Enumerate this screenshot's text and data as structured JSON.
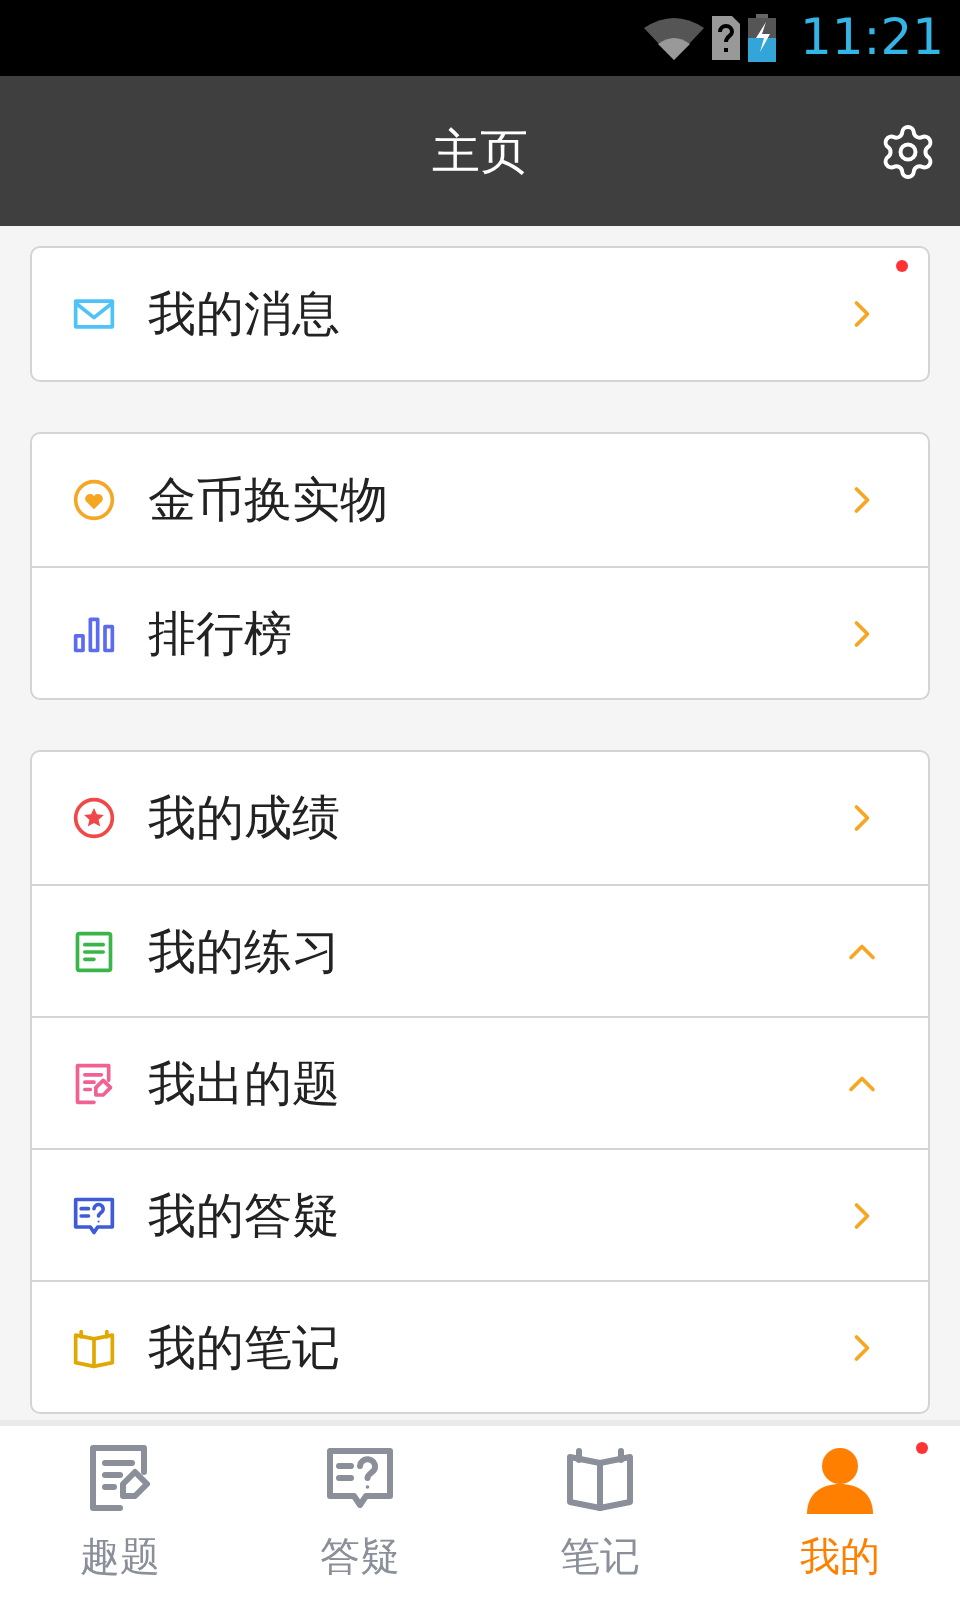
{
  "status_bar": {
    "time": "11:21"
  },
  "header": {
    "title": "主页"
  },
  "groups": [
    {
      "items": [
        {
          "label": "我的消息",
          "expanded": false,
          "badge": true
        }
      ]
    },
    {
      "items": [
        {
          "label": "金币换实物",
          "expanded": false,
          "badge": false
        },
        {
          "label": "排行榜",
          "expanded": false,
          "badge": false
        }
      ]
    },
    {
      "items": [
        {
          "label": "我的成绩",
          "expanded": false,
          "badge": false
        },
        {
          "label": "我的练习",
          "expanded": true,
          "badge": false
        },
        {
          "label": "我出的题",
          "expanded": true,
          "badge": false
        },
        {
          "label": "我的答疑",
          "expanded": false,
          "badge": false
        },
        {
          "label": "我的笔记",
          "expanded": false,
          "badge": false
        }
      ]
    }
  ],
  "tabs": [
    {
      "label": "趣题",
      "selected": false,
      "badge": false
    },
    {
      "label": "答疑",
      "selected": false,
      "badge": false
    },
    {
      "label": "笔记",
      "selected": false,
      "badge": false
    },
    {
      "label": "我的",
      "selected": true,
      "badge": true
    }
  ]
}
